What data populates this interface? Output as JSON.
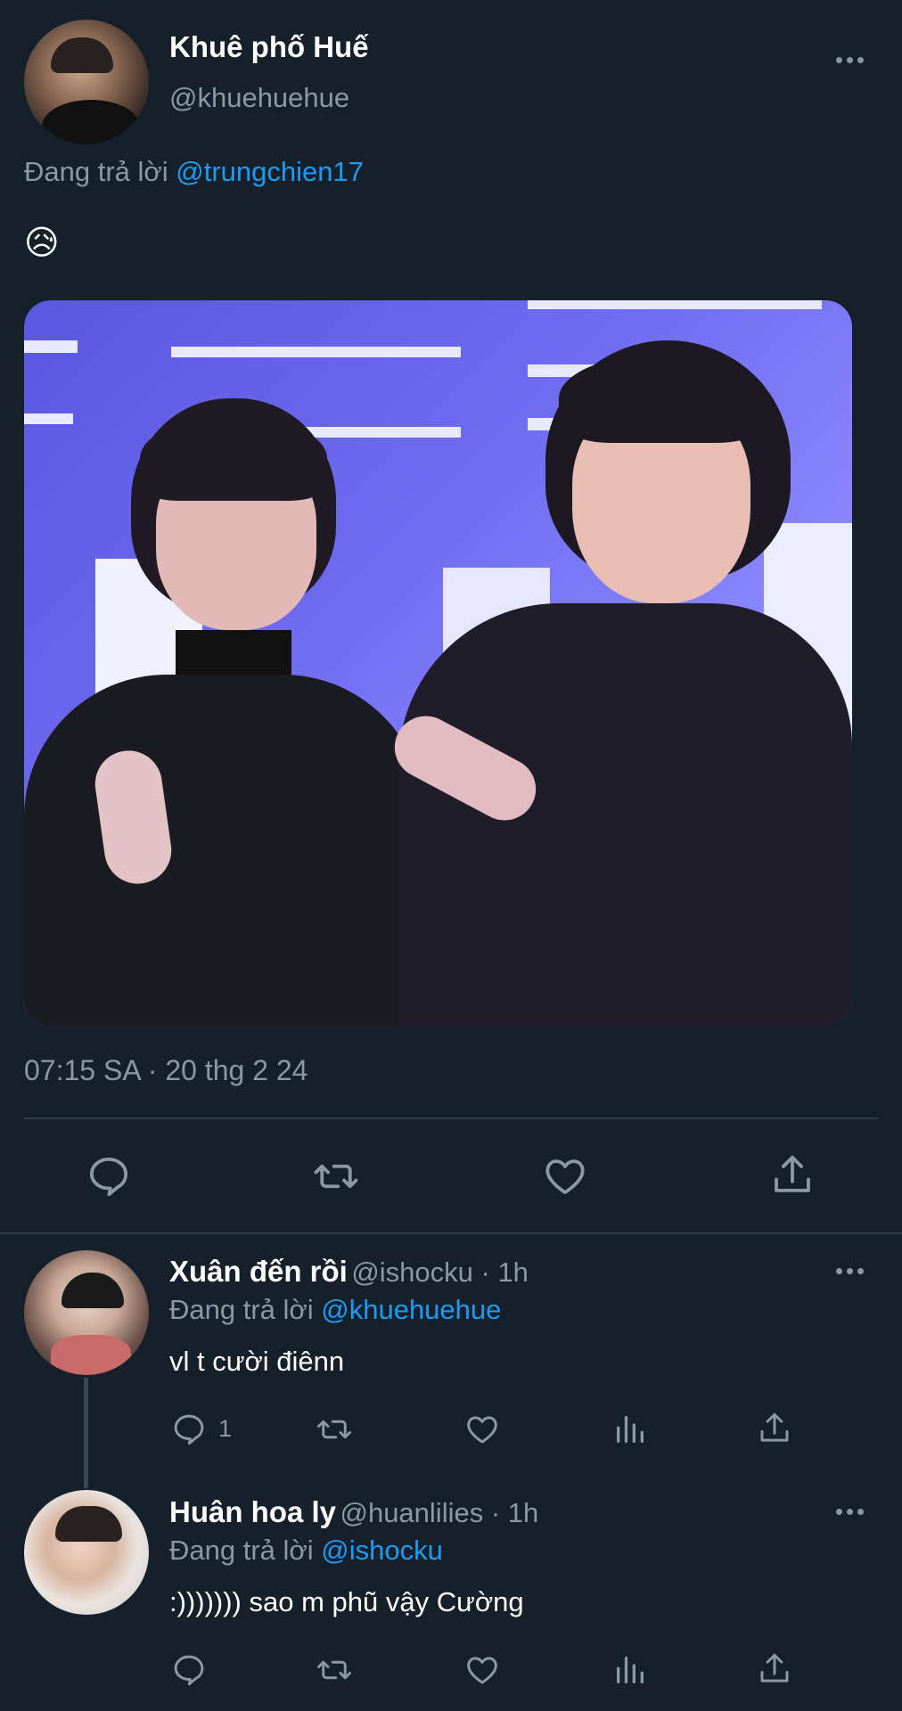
{
  "main_tweet": {
    "author_name": "Khuê phố Huế",
    "author_handle": "@khuehuehue",
    "reply_prefix": "Đang trả lời",
    "reply_to": "@trungchien17",
    "body": "😥",
    "timestamp": "07:15 SA · 20 thg 2 24"
  },
  "replies": [
    {
      "author_name": "Xuân đến rồi",
      "meta": "@ishocku · 1h",
      "reply_prefix": "Đang trả lời",
      "reply_to": "@khuehuehue",
      "body": "vl t cười điênn",
      "reply_count": "1"
    },
    {
      "author_name": "Huân hoa ly",
      "meta": "@huanlilies · 1h",
      "reply_prefix": "Đang trả lời",
      "reply_to": "@ishocku",
      "body": ":))))))) sao m phũ vậy Cường",
      "reply_count": ""
    }
  ],
  "colors": {
    "background": "#15202b",
    "link": "#1d9bf0",
    "muted": "#8b98a5",
    "divider": "#2f3b47"
  },
  "icons": [
    "more-icon",
    "reply-icon",
    "retweet-icon",
    "like-icon",
    "share-icon",
    "analytics-icon"
  ]
}
